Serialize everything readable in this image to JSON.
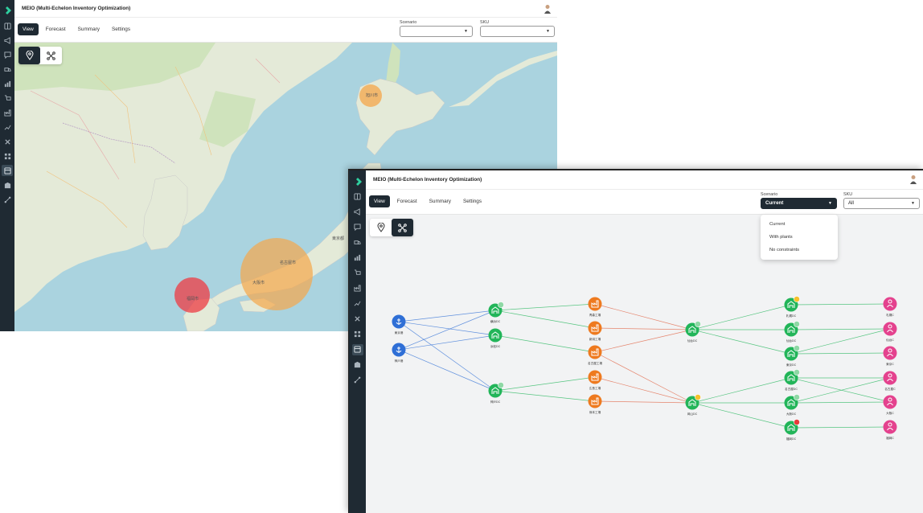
{
  "app": {
    "title": "MEIO (Multi-Echelon Inventory Optimization)"
  },
  "tabs": [
    {
      "label": "View",
      "active": true
    },
    {
      "label": "Forecast"
    },
    {
      "label": "Summary"
    },
    {
      "label": "Settings"
    }
  ],
  "filters": {
    "scenario_label": "Scenario",
    "sku_label": "SKU"
  },
  "window_map": {
    "scenario_value": "",
    "sku_value": ""
  },
  "window_network": {
    "scenario_value": "Current",
    "sku_value": "All",
    "scenario_options": [
      "Current",
      "With plants",
      "No constraints"
    ]
  },
  "sidebar_icons": [
    "home-icon",
    "book-icon",
    "megaphone-icon",
    "chat-icon",
    "truck-icon",
    "bar-chart-icon",
    "cart-icon",
    "factory-icon",
    "line-chart-icon",
    "tools-icon",
    "network-icon",
    "inventory-icon",
    "warehouse-icon",
    "route-icon"
  ],
  "map": {
    "labels": [
      "旭川市",
      "福岡市",
      "名古屋市",
      "大阪市",
      "東京都"
    ]
  },
  "network": {
    "nodes": {
      "ports": [
        "東京港",
        "神戸港"
      ],
      "dc1": [
        "横浜DC",
        "浜松DC",
        "神戸DC"
      ],
      "factories": [
        "青森工場",
        "新潟工場",
        "名古屋工場",
        "広島工場",
        "熊本工場"
      ],
      "hubs": [
        "仙台DC",
        "岡山DC"
      ],
      "dc2": [
        "札幌DC",
        "仙台DC",
        "東京DC",
        "名古屋DC",
        "大阪DC",
        "福岡DC"
      ],
      "customers": [
        "札幌C",
        "仙台C",
        "東京C",
        "名古屋C",
        "大阪C",
        "福岡C"
      ]
    }
  },
  "colors": {
    "sidebar": "#1f2a33",
    "port": "#2f6fd6",
    "dc": "#22b559",
    "factory": "#ee7a1f",
    "customer": "#e4428e",
    "link_blue": "#2f6fd6",
    "link_green": "#22b559",
    "link_red": "#e06040"
  }
}
